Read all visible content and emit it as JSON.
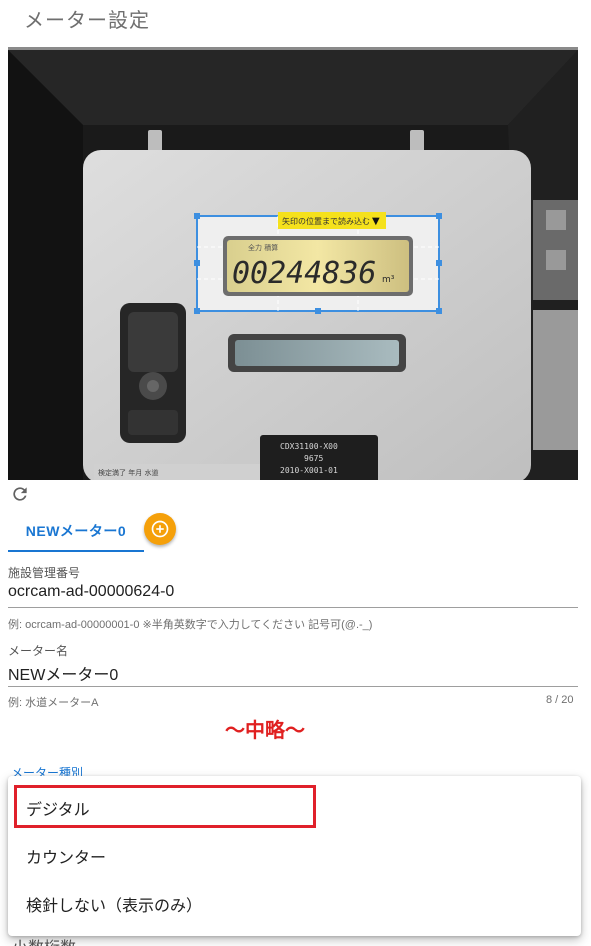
{
  "page": {
    "title": "メーター設定"
  },
  "camera": {
    "lcd_reading": "00244836",
    "lcd_unit": "m³",
    "lcd_caption": "全力 積算",
    "roi_caption": "矢印の位置まで読み込む",
    "roi_arrow": "▼",
    "plate_lines": [
      "CDX31100-X00",
      "9675",
      "2010-X001-01"
    ],
    "sticker_text": "検定満了 年月 水道"
  },
  "refresh": {
    "icon": "refresh-icon"
  },
  "tab": {
    "label": "NEWメーター0",
    "add_icon": "plus-circle-icon"
  },
  "facility": {
    "label": "施設管理番号",
    "value": "ocrcam-ad-00000624-0",
    "hint": "例: ocrcam-ad-00000001-0 ※半角英数字で入力してください 記号可(@.-_)"
  },
  "meter_name": {
    "label": "メーター名",
    "value": "NEWメーター0",
    "hint": "例: 水道メーターA",
    "counter": "8 / 20"
  },
  "omitted_note": "〜中略〜",
  "meter_type": {
    "label": "メーター種別",
    "options": [
      "デジタル",
      "カウンター",
      "検針しない（表示のみ）"
    ]
  },
  "next_field_partial": "小数桁数",
  "colors": {
    "primary": "#1976d2",
    "accent": "#f5a00a",
    "highlight": "#e0202a"
  }
}
